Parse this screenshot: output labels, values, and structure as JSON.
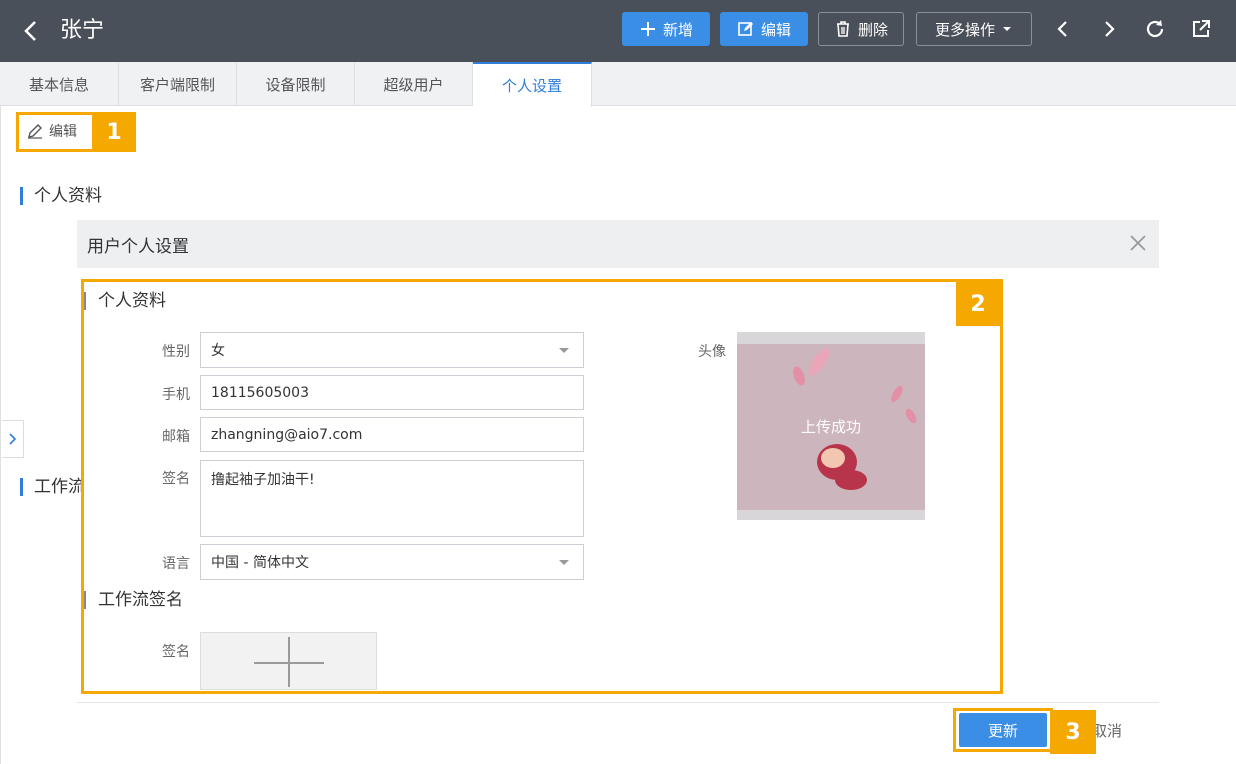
{
  "header": {
    "title": "张宁",
    "buttons": {
      "add": "新增",
      "edit": "编辑",
      "delete": "删除",
      "more": "更多操作"
    },
    "colors": {
      "bg": "#4a5059",
      "primary": "#3a8ee6"
    }
  },
  "tabs": [
    {
      "label": "基本信息"
    },
    {
      "label": "客户端限制"
    },
    {
      "label": "设备限制"
    },
    {
      "label": "超级用户"
    },
    {
      "label": "个人设置",
      "active": true
    }
  ],
  "toolbar": {
    "edit_label": "编辑"
  },
  "callouts": {
    "c1": "1",
    "c2": "2",
    "c3": "3",
    "color": "#f5a800"
  },
  "sections": {
    "personal_profile": "个人资料",
    "workflow_partial": "工作流"
  },
  "dialog": {
    "title": "用户个人设置",
    "profile_section": "个人资料",
    "fields": {
      "gender_label": "性别",
      "gender_value": "女",
      "phone_label": "手机",
      "phone_value": "18115605003",
      "email_label": "邮箱",
      "email_value": "zhangning@aio7.com",
      "signature_label": "签名",
      "signature_value": "撸起袖子加油干!",
      "language_label": "语言",
      "language_value": "中国 - 简体中文",
      "avatar_label": "头像",
      "avatar_status": "上传成功"
    },
    "workflow_section": "工作流签名",
    "workflow_signature_label": "签名",
    "update_label": "更新",
    "cancel_label": "取消"
  }
}
